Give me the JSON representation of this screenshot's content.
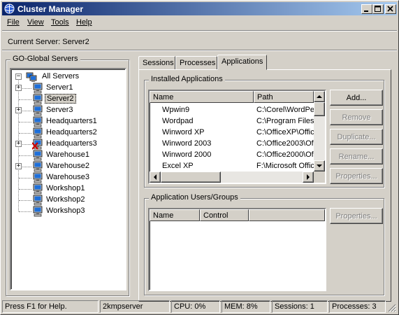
{
  "window": {
    "title": "Cluster Manager"
  },
  "menu": [
    {
      "label": "File"
    },
    {
      "label": "View"
    },
    {
      "label": "Tools"
    },
    {
      "label": "Help"
    }
  ],
  "current_server": {
    "label": "Current Server:",
    "value": "Server2"
  },
  "servers_group": {
    "label": "GO-Global Servers",
    "tree": {
      "root": "All Servers",
      "children": [
        {
          "label": "Server1",
          "expandable": true,
          "status": "online"
        },
        {
          "label": "Server2",
          "expandable": false,
          "status": "online",
          "selected": true
        },
        {
          "label": "Server3",
          "expandable": true,
          "status": "online"
        },
        {
          "label": "Headquarters1",
          "expandable": false,
          "status": "online"
        },
        {
          "label": "Headquarters2",
          "expandable": false,
          "status": "online"
        },
        {
          "label": "Headquarters3",
          "expandable": true,
          "status": "offline"
        },
        {
          "label": "Warehouse1",
          "expandable": false,
          "status": "online"
        },
        {
          "label": "Warehouse2",
          "expandable": true,
          "status": "online"
        },
        {
          "label": "Warehouse3",
          "expandable": false,
          "status": "online"
        },
        {
          "label": "Workshop1",
          "expandable": false,
          "status": "online"
        },
        {
          "label": "Workshop2",
          "expandable": false,
          "status": "online"
        },
        {
          "label": "Workshop3",
          "expandable": false,
          "status": "online"
        }
      ]
    }
  },
  "tabs": [
    {
      "label": "Sessions",
      "active": false
    },
    {
      "label": "Processes",
      "active": false
    },
    {
      "label": "Applications",
      "active": true
    }
  ],
  "installed_apps": {
    "label": "Installed Applications",
    "columns": [
      "Name",
      "Path"
    ],
    "rows": [
      {
        "name": "Wpwin9",
        "path": "C:\\Corel\\WordPe"
      },
      {
        "name": "Wordpad",
        "path": "C:\\Program Files\\"
      },
      {
        "name": "Winword XP",
        "path": "C:\\OfficeXP\\Offic"
      },
      {
        "name": "Winword 2003",
        "path": "C:\\Office2003\\Of"
      },
      {
        "name": "Winword 2000",
        "path": "C:\\Office2000\\Of"
      },
      {
        "name": "Excel XP",
        "path": "F:\\Microsoft Offic"
      }
    ],
    "buttons": {
      "add": {
        "label": "Add...",
        "enabled": true
      },
      "remove": {
        "label": "Remove",
        "enabled": false
      },
      "duplicate": {
        "label": "Duplicate...",
        "enabled": false
      },
      "rename": {
        "label": "Rename...",
        "enabled": false
      },
      "properties": {
        "label": "Properties...",
        "enabled": false
      }
    }
  },
  "app_users": {
    "label": "Application Users/Groups",
    "columns": [
      "Name",
      "Control"
    ],
    "buttons": {
      "properties": {
        "label": "Properties...",
        "enabled": false
      }
    }
  },
  "statusbar": {
    "help": "Press F1 for Help.",
    "server": "2kmpserver",
    "cpu": "CPU: 0%",
    "mem": "MEM: 8%",
    "sessions": "Sessions: 1",
    "processes": "Processes: 3"
  },
  "colors": {
    "titlebar_start": "#0a246a",
    "titlebar_end": "#a6caf0",
    "face": "#d4d0c8",
    "offline_x": "#cc0000"
  }
}
